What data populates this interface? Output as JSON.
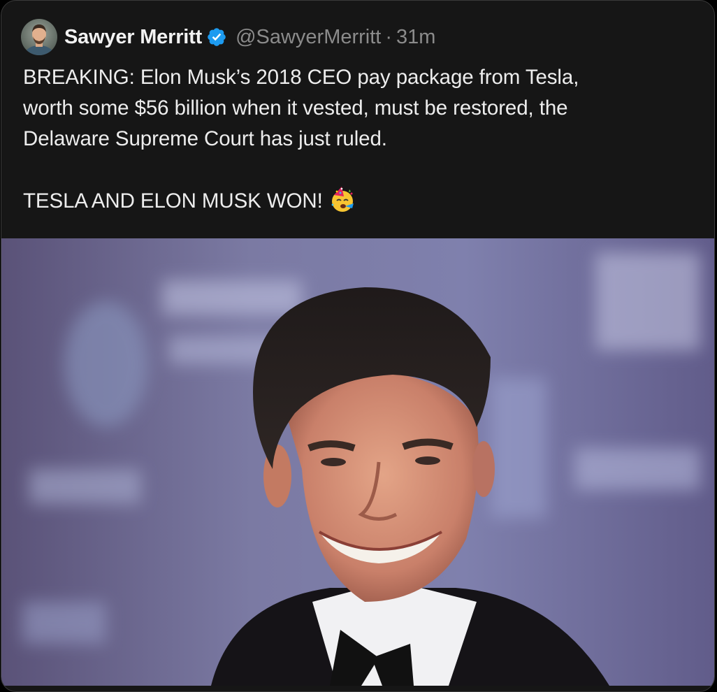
{
  "tweet": {
    "author": {
      "name": "Sawyer Merritt",
      "verified_icon": "verified-badge-icon",
      "handle": "@SawyerMerritt",
      "separator": "·",
      "time": "31m"
    },
    "text": {
      "line1": "BREAKING: Elon Musk’s 2018 CEO pay package from Tesla,",
      "line2": "worth some $56 billion when it vested, must be restored, the",
      "line3": "Delaware Supreme Court has just ruled.",
      "line4": "TESLA AND ELON MUSK WON!",
      "emoji": "partying-face-emoji"
    },
    "media": {
      "type": "photo",
      "subject": "portrait-photo"
    }
  },
  "colors": {
    "card_background": "#161616",
    "text": "#ededed",
    "muted": "#8b8b8b",
    "verified": "#1d9bf0"
  }
}
